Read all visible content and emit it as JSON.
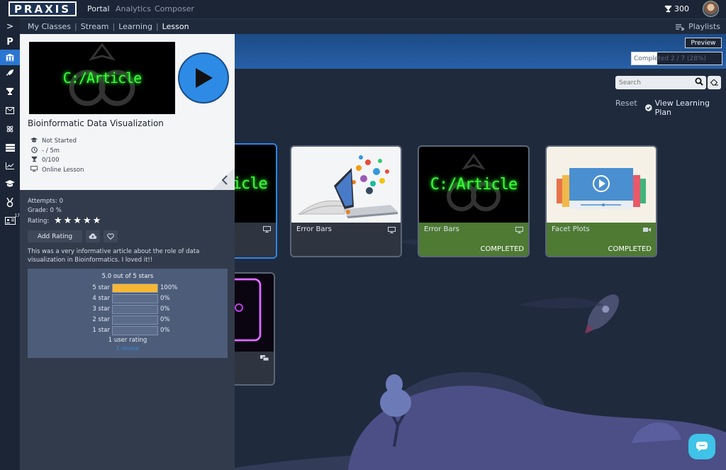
{
  "topnav": {
    "logo": "PRAXIS",
    "links": [
      "Portal",
      "Analytics",
      "Composer"
    ],
    "trophy_points": "300"
  },
  "breadcrumb": {
    "items": [
      "My Classes",
      "Stream",
      "Learning",
      "Lesson"
    ],
    "playlists": "Playlists"
  },
  "rail": {
    "top_chevron": ">",
    "p_label": "P",
    "badge": "17"
  },
  "header": {
    "preview": "Preview",
    "progress_text": "Completed 2 / 7 (28%)",
    "progress_value": 0.28
  },
  "filters": {
    "search_placeholder": "Search",
    "reset": "Reset",
    "view_plan": "View Learning Plan"
  },
  "cards": [
    {
      "title": "Error Bars",
      "status": ""
    },
    {
      "title": "Error Bars",
      "status": "COMPLETED",
      "thumb_text": "C:/Article"
    },
    {
      "title": "Facet Plots",
      "status": "COMPLETED"
    }
  ],
  "selected_card_thumb_text": "C:/Article",
  "panel": {
    "thumb_text": "C:/Article",
    "title": "Bioinformatic Data Visualization",
    "status": "Not Started",
    "duration": "- / 5m",
    "points": "0/100",
    "type": "Online Lesson",
    "attempts": "Attempts:  0",
    "grade": "Grade:  0 %",
    "rating_label": "Rating:",
    "add_rating": "Add Rating",
    "review": "This was a very informative article about the role of data visualization in Bioinformatics. I loved it!!",
    "rating_summary": "5.0 out of 5 stars",
    "rating_rows": [
      {
        "label": "5 star",
        "pct": "100%",
        "value": 1.0
      },
      {
        "label": "4 star",
        "pct": "0%",
        "value": 0
      },
      {
        "label": "3 star",
        "pct": "0%",
        "value": 0
      },
      {
        "label": "2 star",
        "pct": "0%",
        "value": 0
      },
      {
        "label": "1 star",
        "pct": "0%",
        "value": 0
      }
    ],
    "user_ratings": "1 user rating",
    "reviews_link": "1 review"
  }
}
